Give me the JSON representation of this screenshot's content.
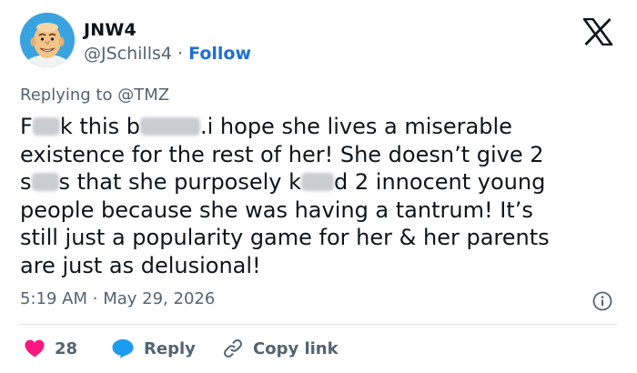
{
  "user": {
    "display_name": "JNW4",
    "handle": "@JSchills4",
    "separator": "·",
    "follow_label": "Follow"
  },
  "reply_context": "Replying to @TMZ",
  "tweet": {
    "lines": [
      [
        "F",
        "k this b",
        ".i hope she lives a miserable"
      ],
      [
        "existence for the rest of her!  She doesn’t give 2"
      ],
      [
        "s",
        "s that she purposely k",
        "d 2 innocent young"
      ],
      [
        "people because she was having a tantrum!  It’s"
      ],
      [
        "still just a popularity game for her & her parents"
      ],
      [
        "are just as delusional!"
      ]
    ]
  },
  "timestamp": {
    "time": "5:19 AM",
    "separator": "·",
    "date": "May 29, 2026"
  },
  "actions": {
    "like_count": "28",
    "reply_label": "Reply",
    "copy_link_label": "Copy link"
  },
  "colors": {
    "like": "#f91880",
    "reply": "#1d9bf0",
    "link": "#1d6fd6",
    "secondary_text": "#536471"
  },
  "icons": {
    "logo": "x-logo-icon",
    "info": "info-icon",
    "like": "heart-icon",
    "reply": "speech-bubble-icon",
    "copy_link": "link-icon"
  }
}
